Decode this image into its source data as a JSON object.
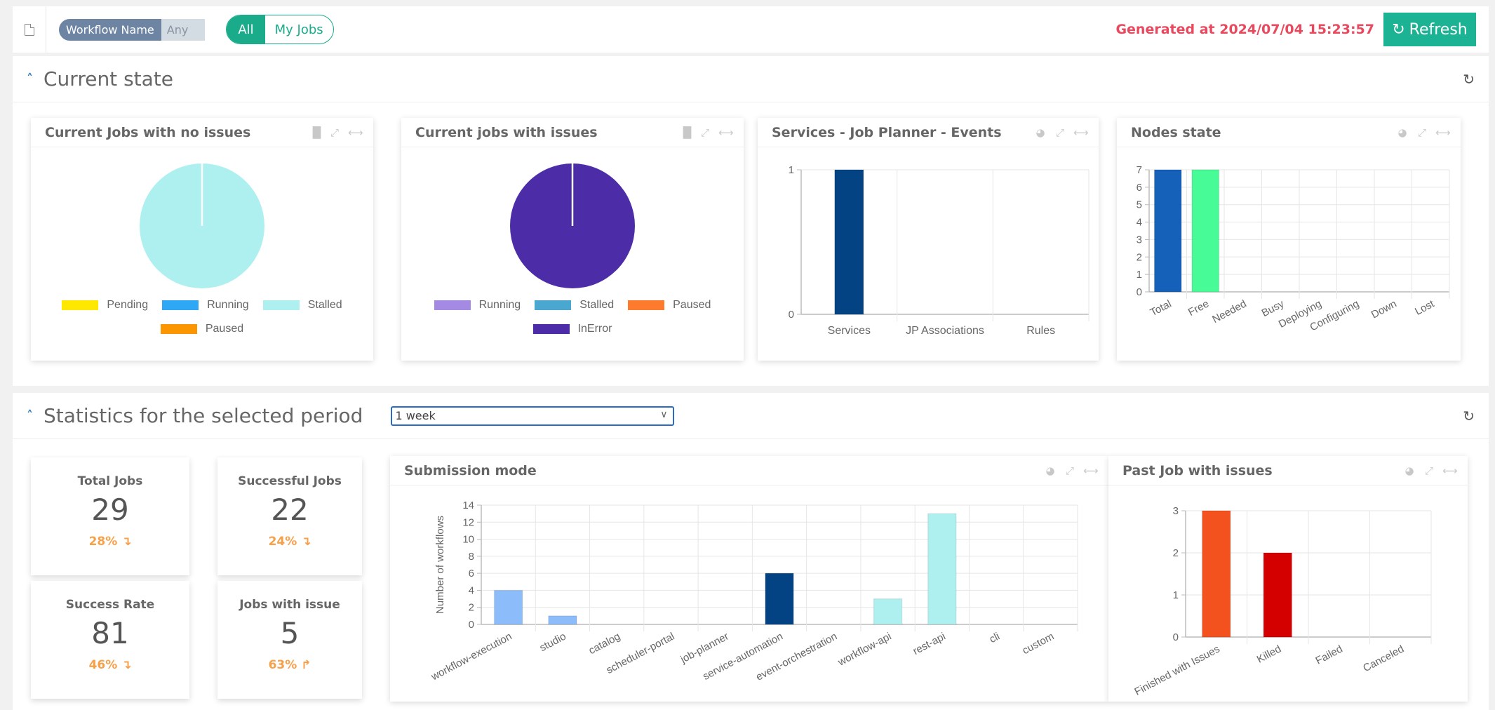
{
  "toolbar": {
    "pdf_icon": "pdf-file-icon",
    "filter_key": "Workflow Name",
    "filter_value": "Any",
    "scope_options": [
      "All",
      "My Jobs"
    ],
    "scope_selected": "All",
    "generated_text": "Generated at 2024/07/04 15:23:57",
    "refresh_label": "Refresh",
    "refresh_icon": "refresh-icon"
  },
  "current_state": {
    "title": "Current state",
    "panels": {
      "no_issues": {
        "title": "Current Jobs with no issues",
        "legend": [
          {
            "label": "Pending",
            "color": "#ffe800"
          },
          {
            "label": "Running",
            "color": "#2ea8f5"
          },
          {
            "label": "Stalled",
            "color": "#aef0f0"
          },
          {
            "label": "Paused",
            "color": "#fb9600"
          }
        ]
      },
      "with_issues": {
        "title": "Current jobs with issues",
        "legend": [
          {
            "label": "Running",
            "color": "#a48ae2"
          },
          {
            "label": "Stalled",
            "color": "#4aa8d0"
          },
          {
            "label": "Paused",
            "color": "#fe7b2e"
          },
          {
            "label": "InError",
            "color": "#4c2da7"
          }
        ]
      },
      "services": {
        "title": "Services - Job Planner - Events"
      },
      "nodes": {
        "title": "Nodes state"
      }
    }
  },
  "statistics": {
    "title": "Statistics for the selected period",
    "period_selected": "1 week",
    "kpis": [
      {
        "label": "Total Jobs",
        "value": "29",
        "delta": "28% ↴"
      },
      {
        "label": "Successful Jobs",
        "value": "22",
        "delta": "24% ↴"
      },
      {
        "label": "Success Rate",
        "value": "81",
        "delta": "46% ↴"
      },
      {
        "label": "Jobs with issue",
        "value": "5",
        "delta": "63% ↱"
      }
    ],
    "panels": {
      "submission": {
        "title": "Submission mode"
      },
      "past_issues": {
        "title": "Past Job with issues"
      }
    }
  },
  "chart_data": [
    {
      "id": "no_issues",
      "type": "pie",
      "title": "Current Jobs with no issues",
      "categories": [
        "Pending",
        "Running",
        "Stalled",
        "Paused"
      ],
      "values": [
        0,
        0,
        1,
        0
      ],
      "colors": [
        "#ffe800",
        "#2ea8f5",
        "#aef0f0",
        "#fb9600"
      ],
      "legend": "bottom"
    },
    {
      "id": "with_issues",
      "type": "pie",
      "title": "Current jobs with issues",
      "categories": [
        "Running",
        "Stalled",
        "Paused",
        "InError"
      ],
      "values": [
        0,
        0,
        0,
        1
      ],
      "colors": [
        "#a48ae2",
        "#4aa8d0",
        "#fe7b2e",
        "#4c2da7"
      ],
      "legend": "bottom"
    },
    {
      "id": "services",
      "type": "bar",
      "title": "Services - Job Planner - Events",
      "categories": [
        "Services",
        "JP Associations",
        "Rules"
      ],
      "values": [
        1,
        0,
        0
      ],
      "colors": [
        "#034383",
        "#034383",
        "#034383"
      ],
      "ylim": [
        0,
        1
      ],
      "yticks": [
        0,
        1
      ],
      "xlabel": "",
      "ylabel": "",
      "rotate_labels": false,
      "grid": true
    },
    {
      "id": "nodes",
      "type": "bar",
      "title": "Nodes state",
      "categories": [
        "Total",
        "Free",
        "Needed",
        "Busy",
        "Deploying",
        "Configuring",
        "Down",
        "Lost"
      ],
      "values": [
        7,
        7,
        0,
        0,
        0,
        0,
        0,
        0
      ],
      "colors": [
        "#1560b8",
        "#47fb96",
        "#888",
        "#888",
        "#888",
        "#888",
        "#888",
        "#888"
      ],
      "ylim": [
        0,
        7
      ],
      "yticks": [
        0,
        1,
        2,
        3,
        4,
        5,
        6,
        7
      ],
      "xlabel": "",
      "ylabel": "",
      "rotate_labels": true,
      "grid": true
    },
    {
      "id": "submission",
      "type": "bar",
      "title": "Submission mode",
      "categories": [
        "workflow-execution",
        "studio",
        "catalog",
        "scheduler-portal",
        "job-planner",
        "service-automation",
        "event-orchestration",
        "workflow-api",
        "rest-api",
        "cli",
        "custom"
      ],
      "values": [
        4,
        1,
        0,
        0,
        0,
        6,
        0,
        3,
        13,
        0,
        0
      ],
      "colors": [
        "#8cbcf9",
        "#8cbcf9",
        "#8cbcf9",
        "#8cbcf9",
        "#8cbcf9",
        "#034383",
        "#034383",
        "#aef0f0",
        "#aef0f0",
        "#aef0f0",
        "#aef0f0"
      ],
      "ylim": [
        0,
        14
      ],
      "yticks": [
        0,
        2,
        4,
        6,
        8,
        10,
        12,
        14
      ],
      "xlabel": "",
      "ylabel": "Number of workflows",
      "rotate_labels": true,
      "grid": true
    },
    {
      "id": "past_issues",
      "type": "bar",
      "title": "Past Job with issues",
      "categories": [
        "Finished with Issues",
        "Killed",
        "Failed",
        "Canceled"
      ],
      "values": [
        3,
        2,
        0,
        0
      ],
      "colors": [
        "#f3521f",
        "#d40000",
        "#888",
        "#888"
      ],
      "ylim": [
        0,
        3
      ],
      "yticks": [
        0,
        1,
        2,
        3
      ],
      "xlabel": "",
      "ylabel": "",
      "rotate_labels": true,
      "grid": true
    }
  ]
}
